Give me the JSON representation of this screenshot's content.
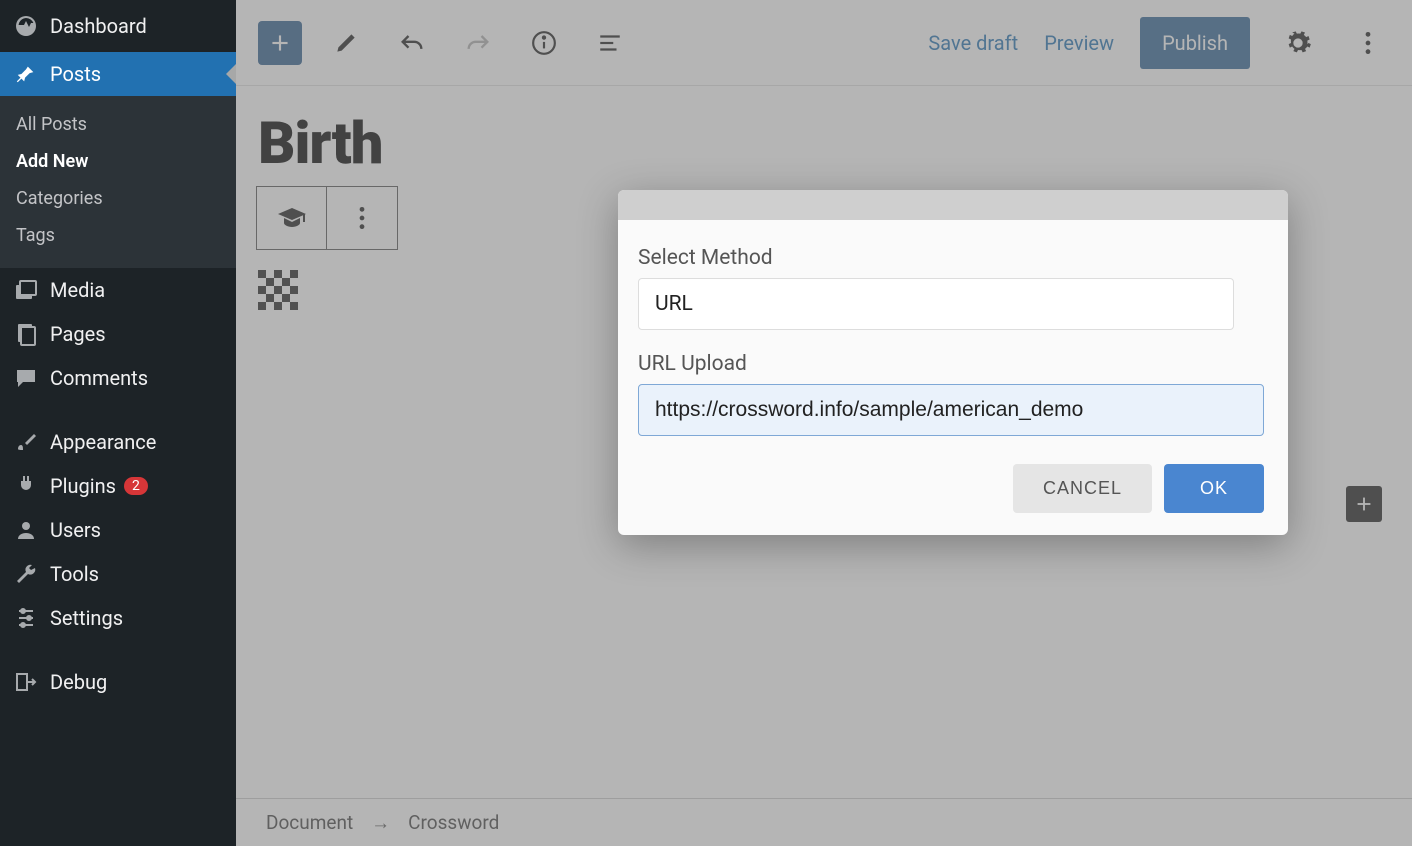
{
  "sidebar": {
    "dashboard": "Dashboard",
    "posts": "Posts",
    "submenu": {
      "all": "All Posts",
      "add": "Add New",
      "categories": "Categories",
      "tags": "Tags"
    },
    "media": "Media",
    "pages": "Pages",
    "comments": "Comments",
    "appearance": "Appearance",
    "plugins": "Plugins",
    "plugins_badge": "2",
    "users": "Users",
    "tools": "Tools",
    "settings": "Settings",
    "debug": "Debug"
  },
  "toolbar": {
    "save_draft": "Save draft",
    "preview": "Preview",
    "publish": "Publish"
  },
  "post": {
    "title": "Birth"
  },
  "breadcrumb": {
    "doc": "Document",
    "block": "Crossword"
  },
  "modal": {
    "select_method_label": "Select Method",
    "method_value": "URL",
    "url_label": "URL Upload",
    "url_value": "https://crossword.info/sample/american_demo",
    "cancel": "CANCEL",
    "ok": "OK"
  }
}
